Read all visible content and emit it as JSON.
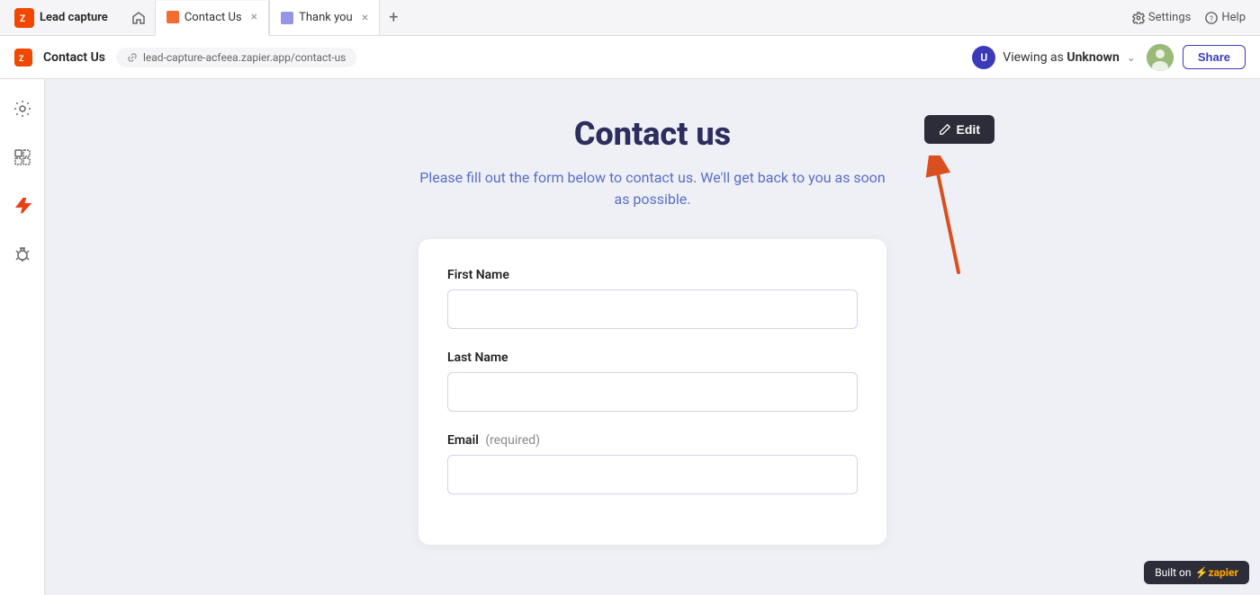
{
  "app": {
    "name": "Lead capture",
    "logo_color": "#f04800"
  },
  "tabs": [
    {
      "id": "home",
      "type": "home",
      "label": ""
    },
    {
      "id": "contact-us",
      "type": "page",
      "label": "Contact Us",
      "active": true,
      "closable": true
    },
    {
      "id": "thank-you",
      "type": "page",
      "label": "Thank you",
      "active": false,
      "closable": true
    }
  ],
  "tab_actions": {
    "settings": "Settings",
    "help": "Help"
  },
  "address_bar": {
    "page_title": "Contact Us",
    "url": "lead-capture-acfeea.zapier.app/contact-us",
    "viewing_label": "Viewing as",
    "viewing_user": "Unknown",
    "share_label": "Share"
  },
  "sidebar": {
    "items": [
      {
        "id": "settings",
        "icon": "⚙️"
      },
      {
        "id": "layout",
        "icon": "▦"
      },
      {
        "id": "zap",
        "icon": "⚡",
        "active": true
      },
      {
        "id": "bug",
        "icon": "🐛"
      }
    ]
  },
  "form": {
    "title": "Contact us",
    "subtitle": "Please fill out the form below to contact us. We'll get back to you as soon as possible.",
    "edit_button": "Edit",
    "fields": [
      {
        "id": "first-name",
        "label": "First Name",
        "required": false,
        "placeholder": ""
      },
      {
        "id": "last-name",
        "label": "Last Name",
        "required": false,
        "placeholder": ""
      },
      {
        "id": "email",
        "label": "Email",
        "required": true,
        "required_label": "(required)",
        "placeholder": ""
      }
    ]
  },
  "badge": {
    "prefix": "Built on",
    "brand": "zapier"
  }
}
